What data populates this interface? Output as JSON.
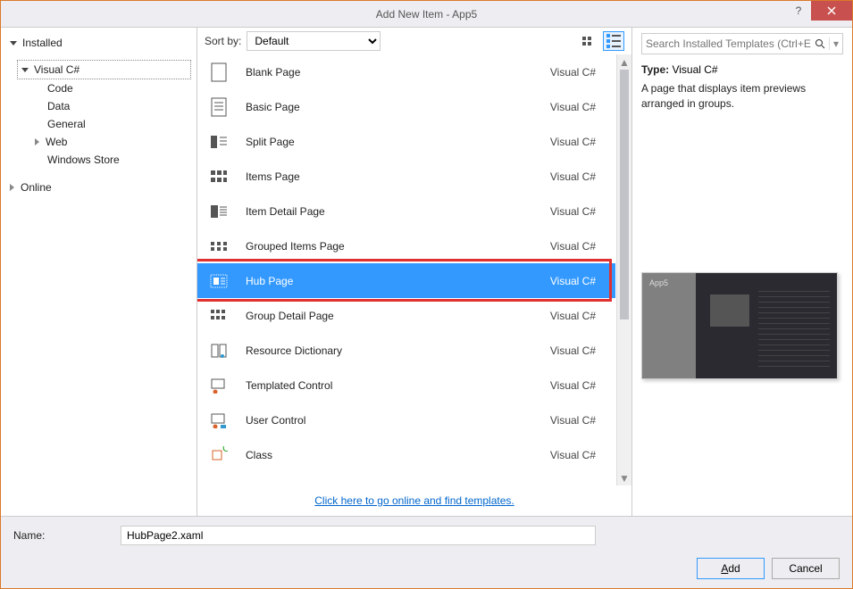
{
  "window": {
    "title": "Add New Item - App5"
  },
  "sidebar": {
    "installed": "Installed",
    "vcs": "Visual C#",
    "items": [
      "Code",
      "Data",
      "General",
      "Web",
      "Windows Store"
    ],
    "online": "Online"
  },
  "toolbar": {
    "sortby": "Sort by:",
    "sortval": "Default"
  },
  "templates": [
    {
      "name": "Blank Page",
      "lang": "Visual C#"
    },
    {
      "name": "Basic Page",
      "lang": "Visual C#"
    },
    {
      "name": "Split Page",
      "lang": "Visual C#"
    },
    {
      "name": "Items Page",
      "lang": "Visual C#"
    },
    {
      "name": "Item Detail Page",
      "lang": "Visual C#"
    },
    {
      "name": "Grouped Items Page",
      "lang": "Visual C#"
    },
    {
      "name": "Hub Page",
      "lang": "Visual C#",
      "selected": true
    },
    {
      "name": "Group Detail Page",
      "lang": "Visual C#"
    },
    {
      "name": "Resource Dictionary",
      "lang": "Visual C#"
    },
    {
      "name": "Templated Control",
      "lang": "Visual C#"
    },
    {
      "name": "User Control",
      "lang": "Visual C#"
    },
    {
      "name": "Class",
      "lang": "Visual C#"
    }
  ],
  "footerlink": "Click here to go online and find templates.",
  "search": {
    "placeholder": "Search Installed Templates (Ctrl+E)"
  },
  "info": {
    "typelabel": "Type:",
    "typeval": "Visual C#",
    "desc": "A page that displays item previews arranged in groups."
  },
  "name": {
    "label": "Name:",
    "value": "HubPage2.xaml"
  },
  "buttons": {
    "add": "Add",
    "cancel": "Cancel"
  },
  "preview": {
    "title": "App5"
  }
}
